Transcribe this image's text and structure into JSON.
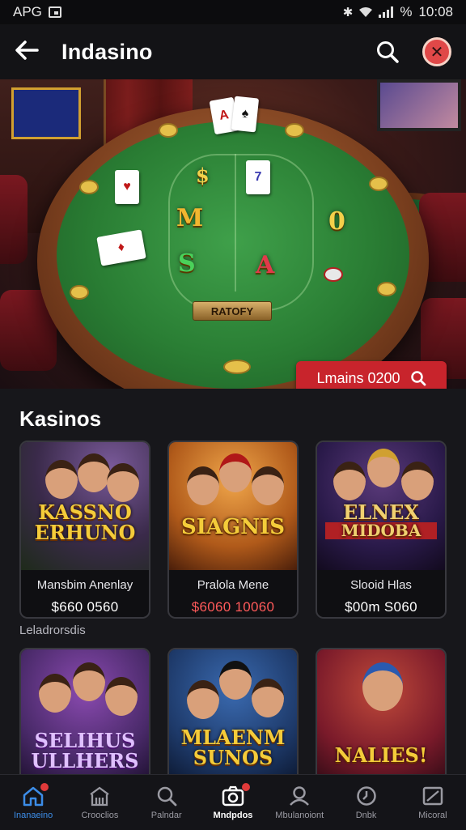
{
  "status_bar": {
    "carrier": "APG",
    "time": "10:08",
    "battery_text": "%"
  },
  "app_bar": {
    "title": "Indasino"
  },
  "hero": {
    "plaque_text": "RATOFY",
    "cta_label": "Lmains 0200",
    "tokens": [
      "M",
      "S",
      "A",
      "$",
      "0"
    ]
  },
  "sections": {
    "main_title": "Kasinos",
    "sub_label": "Leladrorsdis"
  },
  "games": [
    {
      "logo_line1": "KASSNO",
      "logo_line2": "ERHUNO",
      "name": "Mansbim Anenlay",
      "price": "$660 0560",
      "price_color": "#ffffff"
    },
    {
      "logo_line1": "SIAGNIS",
      "logo_line2": "",
      "name": "Pralola Mene",
      "price": "$6060 10060",
      "price_color": "#ff5a5a"
    },
    {
      "logo_line1": "ELNEX",
      "logo_line2": "MIDOBA",
      "name": "Slooid Hlas",
      "price": "$00m S060",
      "price_color": "#ffffff"
    },
    {
      "logo_line1": "SELIHUS",
      "logo_line2": "ULLHERS",
      "name": "",
      "price": ""
    },
    {
      "logo_line1": "MLAENM",
      "logo_line2": "SUNOS",
      "name": "",
      "price": ""
    },
    {
      "logo_line1": "NALIES!",
      "logo_line2": "",
      "name": "",
      "price": ""
    }
  ],
  "bottom_nav": [
    {
      "label": "Inanaeino",
      "icon": "home-icon",
      "active": true
    },
    {
      "label": "Crooclios",
      "icon": "casino-building-icon"
    },
    {
      "label": "Palndar",
      "icon": "search-icon"
    },
    {
      "label": "Mndpdos",
      "icon": "camera-icon",
      "bold": true
    },
    {
      "label": "Mbulanoiont",
      "icon": "profile-icon"
    },
    {
      "label": "Dnbk",
      "icon": "clock-icon"
    },
    {
      "label": "Micoral",
      "icon": "board-icon"
    }
  ],
  "colors": {
    "accent_red": "#c8242c",
    "nav_active": "#3c8de8",
    "background": "#17171b"
  }
}
